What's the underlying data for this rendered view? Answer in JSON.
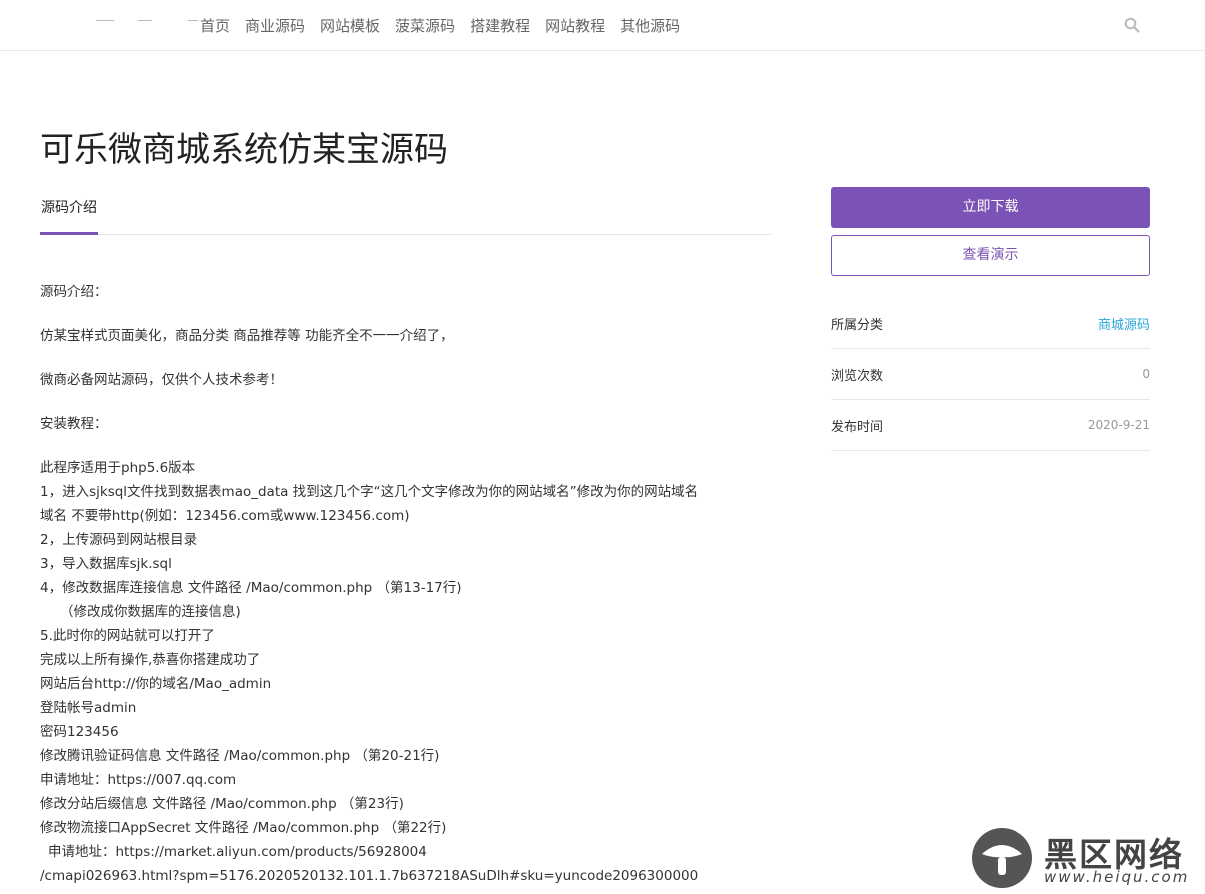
{
  "header": {
    "nav": [
      "首页",
      "商业源码",
      "网站模板",
      "菠菜源码",
      "搭建教程",
      "网站教程",
      "其他源码"
    ],
    "search_icon": "search-icon"
  },
  "page_title": "可乐微商城系统仿某宝源码",
  "tabs": {
    "active": "源码介绍"
  },
  "content": {
    "intro_heading": "源码介绍：",
    "intro_p1": "仿某宝样式页面美化，商品分类 商品推荐等 功能齐全不一一介绍了，",
    "intro_p2": "微商必备网站源码，仅供个人技术参考！",
    "install_heading": "安装教程：",
    "lines": [
      "此程序适用于php5.6版本",
      "1，进入sjksql文件找到数据表mao_data  找到这几个字“这几个文字修改为你的网站域名”修改为你的网站域名",
      "域名 不要带http(例如：123456.com或www.123456.com)",
      "2，上传源码到网站根目录",
      "3，导入数据库sjk.sql",
      "4，修改数据库连接信息 文件路径 /Mao/common.php  （第13-17行)",
      "（修改成你数据库的连接信息)",
      "5.此时你的网站就可以打开了",
      "完成以上所有操作,恭喜你搭建成功了",
      "网站后台http://你的域名/Mao_admin",
      "登陆帐号admin",
      "密码123456",
      "修改腾讯验证码信息 文件路径 /Mao/common.php  （第20-21行)",
      "申请地址：https://007.qq.com",
      "修改分站后缀信息 文件路径 /Mao/common.php  （第23行)",
      "修改物流接口AppSecret 文件路径 /Mao/common.php  （第22行)",
      "申请地址：https://market.aliyun.com/products/56928004",
      "/cmapi026963.html?spm=5176.2020520132.101.1.7b637218ASuDlh#sku=yuncode2096300000"
    ]
  },
  "sidebar": {
    "download_label": "立即下载",
    "demo_label": "查看演示",
    "meta": [
      {
        "label": "所属分类",
        "value": "商城源码"
      },
      {
        "label": "浏览次数",
        "value": "0"
      },
      {
        "label": "发布时间",
        "value": "2020-9-21"
      }
    ],
    "accent_color": "#7b52b5",
    "link_color": "#2aa6d9"
  },
  "watermark": {
    "title": "黑区网络",
    "url": "www.heiqu.com"
  }
}
